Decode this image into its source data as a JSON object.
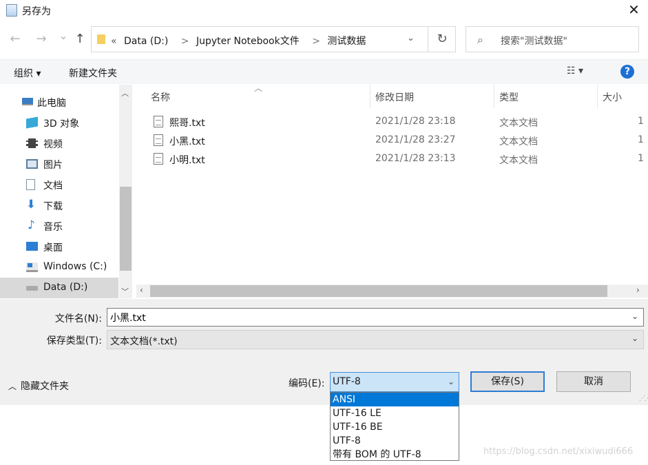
{
  "window": {
    "title": "另存为",
    "close_glyph": "✕"
  },
  "nav": {
    "back_glyph": "←",
    "forward_glyph": "→",
    "recent_glyph": "⌄",
    "up_glyph": "↑",
    "path_prefix": "«",
    "path": [
      "Data (D:)",
      "Jupyter Notebook文件",
      "测试数据"
    ],
    "path_separator": ">",
    "refresh_glyph": "↻",
    "search_placeholder": "搜索\"测试数据\""
  },
  "toolbar": {
    "organize": "组织 ▾",
    "new_folder": "新建文件夹",
    "view_glyph": "☷ ▾",
    "help": "?"
  },
  "sidebar": {
    "items": [
      {
        "label": "此电脑",
        "icon": "computer-icon",
        "color": "#3b7dc4"
      },
      {
        "label": "3D 对象",
        "icon": "cube-icon",
        "color": "#36a9d8"
      },
      {
        "label": "视频",
        "icon": "film-icon",
        "color": "#444444"
      },
      {
        "label": "图片",
        "icon": "picture-icon",
        "color": "#5b7d9c"
      },
      {
        "label": "文档",
        "icon": "document-icon",
        "color": "#7a8ea3"
      },
      {
        "label": "下载",
        "icon": "download-icon",
        "color": "#2d7fd3"
      },
      {
        "label": "音乐",
        "icon": "music-icon",
        "color": "#2d7fd3"
      },
      {
        "label": "桌面",
        "icon": "desktop-icon",
        "color": "#2d7fd3"
      },
      {
        "label": "Windows (C:)",
        "icon": "windows-drive-icon",
        "color": "#2d7fd3"
      },
      {
        "label": "Data (D:)",
        "icon": "drive-icon",
        "color": "#777777"
      }
    ],
    "selected_index": 9
  },
  "file_list": {
    "columns": [
      "名称",
      "修改日期",
      "类型",
      "大小"
    ],
    "rows": [
      {
        "name": "熙哥.txt",
        "date": "2021/1/28 23:18",
        "type": "文本文档",
        "size": "1"
      },
      {
        "name": "小黑.txt",
        "date": "2021/1/28 23:27",
        "type": "文本文档",
        "size": "1"
      },
      {
        "name": "小明.txt",
        "date": "2021/1/28 23:13",
        "type": "文本文档",
        "size": "1"
      }
    ]
  },
  "form": {
    "filename_label": "文件名(N):",
    "filename_value": "小黑.txt",
    "filetype_label": "保存类型(T):",
    "filetype_value": "文本文档(*.txt)",
    "hide_folders": "隐藏文件夹",
    "encoding_label": "编码(E):",
    "encoding_value": "UTF-8",
    "save_button": "保存(S)",
    "cancel_button": "取消"
  },
  "encoding_popup": {
    "options": [
      "ANSI",
      "UTF-16 LE",
      "UTF-16 BE",
      "UTF-8",
      "带有 BOM 的 UTF-8"
    ],
    "highlighted_index": 0
  },
  "watermark": "https://blog.csdn.net/xixiwudi666"
}
